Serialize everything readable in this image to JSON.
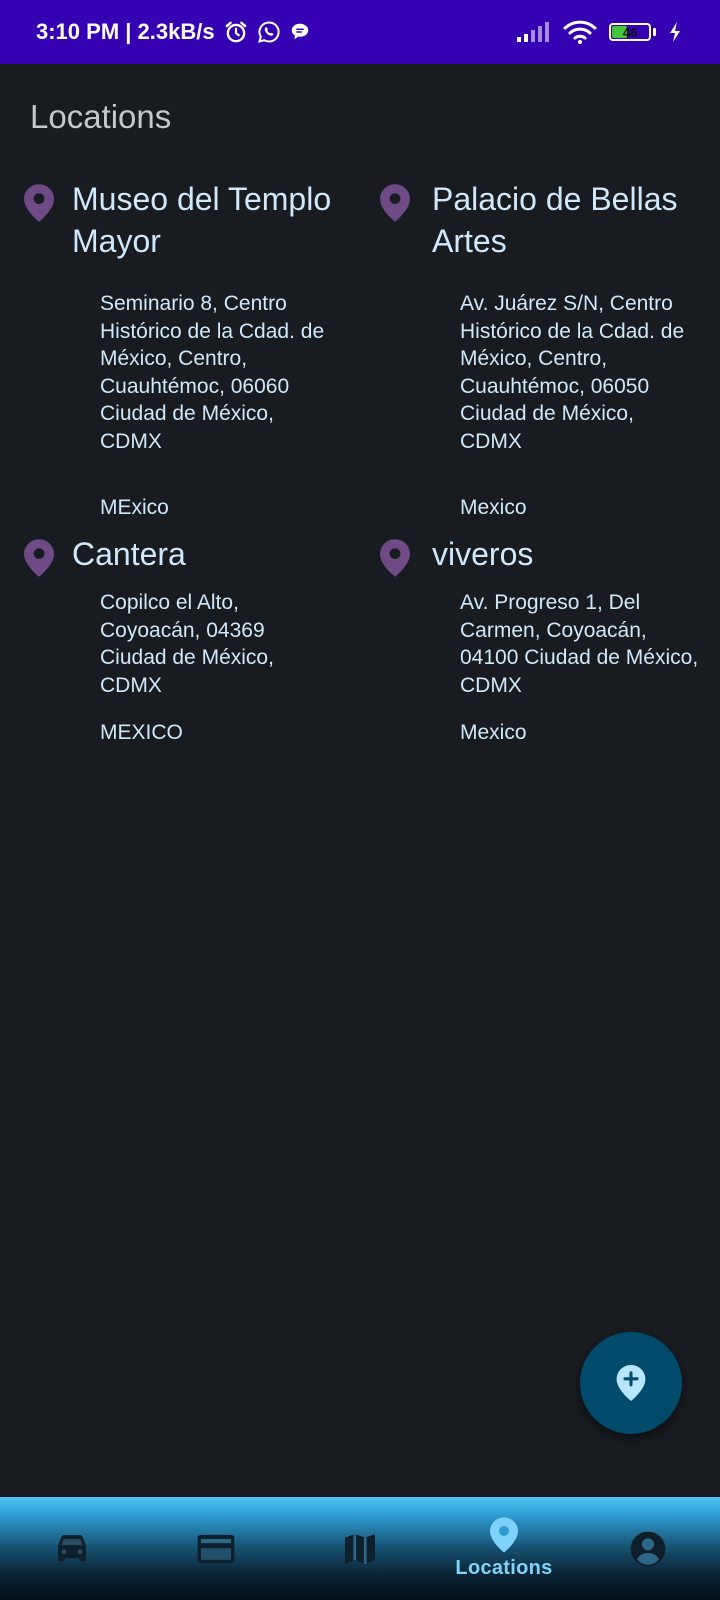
{
  "status_bar": {
    "time_speed": "3:10 PM | 2.3kB/s",
    "battery_level": "46",
    "battery_percent": 46,
    "icons": [
      "alarm-icon",
      "whatsapp-icon",
      "chat-bubble-icon",
      "signal-icon",
      "wifi-icon",
      "battery-icon",
      "charging-icon"
    ]
  },
  "header": {
    "title": "Locations"
  },
  "locations": [
    {
      "name": "Museo del Templo Mayor",
      "address": "Seminario 8, Centro Histórico de la Cdad. de México, Centro, Cuauhtémoc, 06060 Ciudad de México, CDMX",
      "country": "MExico"
    },
    {
      "name": "Palacio de Bellas Artes",
      "address": "Av. Juárez S/N, Centro Histórico de la Cdad. de México, Centro, Cuauhtémoc, 06050 Ciudad de México, CDMX",
      "country": "Mexico"
    },
    {
      "name": "Cantera",
      "address": "Copilco el Alto, Coyoacán, 04369 Ciudad de México, CDMX",
      "country": "MEXICO"
    },
    {
      "name": "viveros",
      "address": "Av. Progreso 1, Del Carmen, Coyoacán, 04100 Ciudad de México, CDMX",
      "country": "Mexico"
    }
  ],
  "fab": {
    "icon": "add-location-icon"
  },
  "bottom_nav": {
    "items": [
      {
        "icon": "car-icon",
        "label": ""
      },
      {
        "icon": "credit-card-icon",
        "label": ""
      },
      {
        "icon": "map-icon",
        "label": ""
      },
      {
        "icon": "location-pin-icon",
        "label": "Locations"
      },
      {
        "icon": "account-circle-icon",
        "label": ""
      }
    ],
    "active_index": 3
  },
  "colors": {
    "status_bar": "#3600b3",
    "background": "#181b20",
    "title_text": "#c4c7cc",
    "card_text": "#cfe8fb",
    "pin": "#6e4a86",
    "fab": "#004b6b",
    "fab_icon": "#b9e6ff",
    "nav_active": "#7fd3fa",
    "nav_icon": "#10202b"
  }
}
